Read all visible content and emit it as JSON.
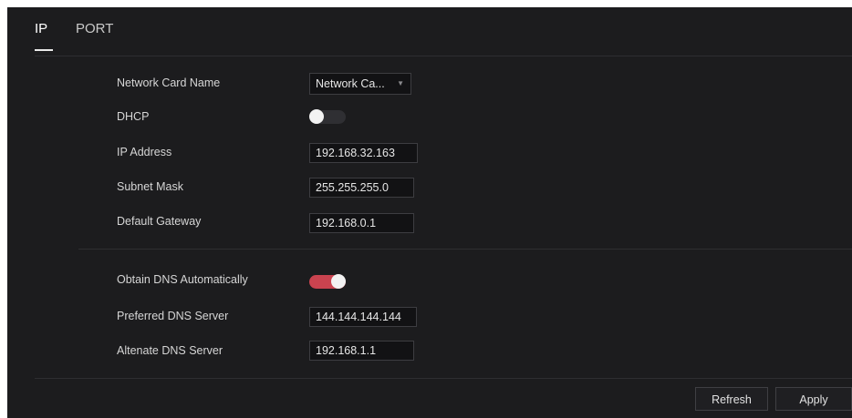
{
  "tabs": [
    {
      "label": "IP",
      "active": true
    },
    {
      "label": "PORT",
      "active": false
    }
  ],
  "form": {
    "network_card": {
      "label": "Network Card Name",
      "value": "Network Ca..."
    },
    "dhcp": {
      "label": "DHCP",
      "enabled": false
    },
    "ip_address": {
      "label": "IP Address",
      "value": "192.168.32.163"
    },
    "subnet_mask": {
      "label": "Subnet Mask",
      "value": "255.255.255.0"
    },
    "default_gateway": {
      "label": "Default Gateway",
      "value": "192.168.0.1"
    },
    "obtain_dns": {
      "label": "Obtain DNS Automatically",
      "enabled": true
    },
    "preferred_dns": {
      "label": "Preferred DNS Server",
      "value": "144.144.144.144"
    },
    "alternate_dns": {
      "label": "Altenate DNS Server",
      "value": "192.168.1.1"
    }
  },
  "actions": {
    "refresh_label": "Refresh",
    "apply_label": "Apply"
  },
  "colors": {
    "background": "#1c1c1e",
    "accent": "#c9434f",
    "text": "#d6d6d6"
  }
}
